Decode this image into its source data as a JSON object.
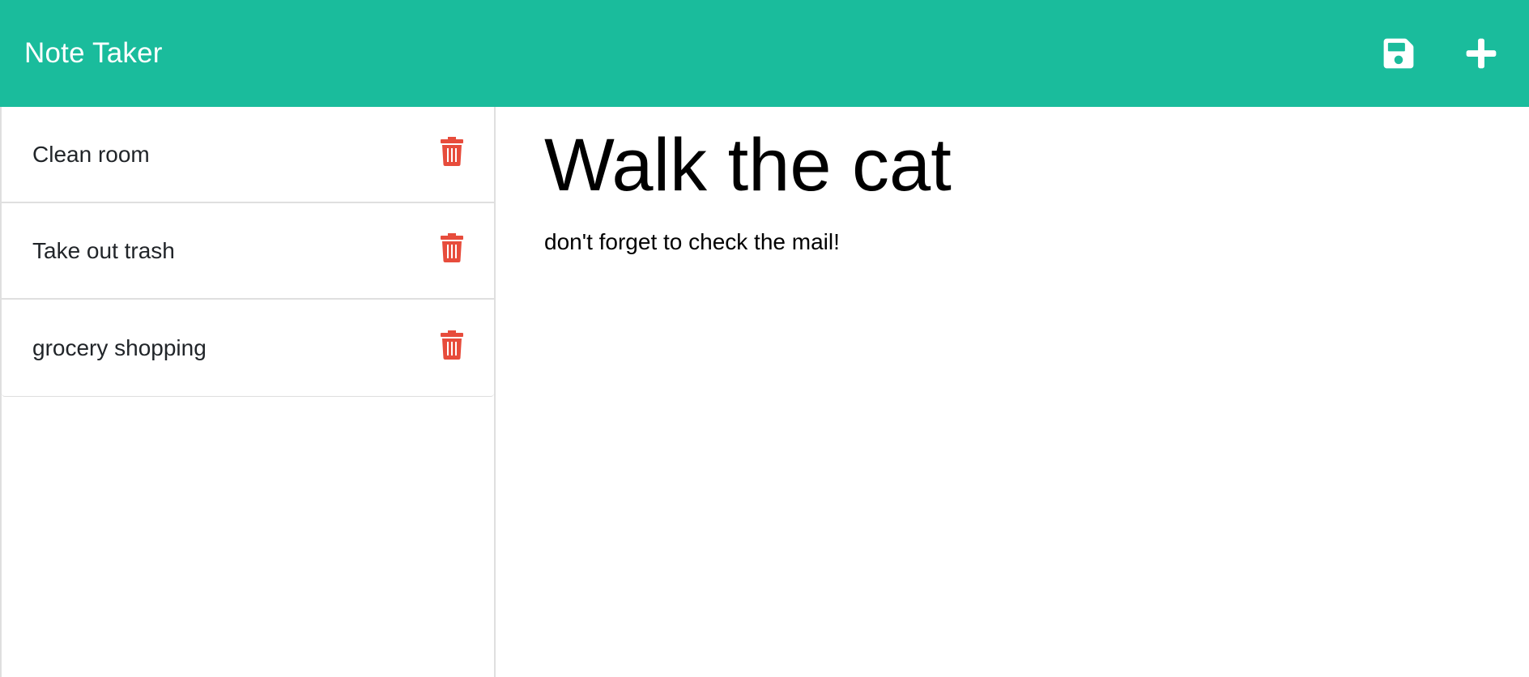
{
  "navbar": {
    "brand": "Note Taker",
    "save_icon": "floppy-disk",
    "new_icon": "plus",
    "color": "#1abc9c"
  },
  "sidebar": {
    "notes": [
      {
        "title": "Clean room",
        "delete_icon": "trash-can"
      },
      {
        "title": "Take out trash",
        "delete_icon": "trash-can"
      },
      {
        "title": "grocery shopping",
        "delete_icon": "trash-can"
      }
    ],
    "delete_color": "#e74c3c"
  },
  "editor": {
    "title": "Walk the cat",
    "body": "don't forget to check the mail!"
  }
}
